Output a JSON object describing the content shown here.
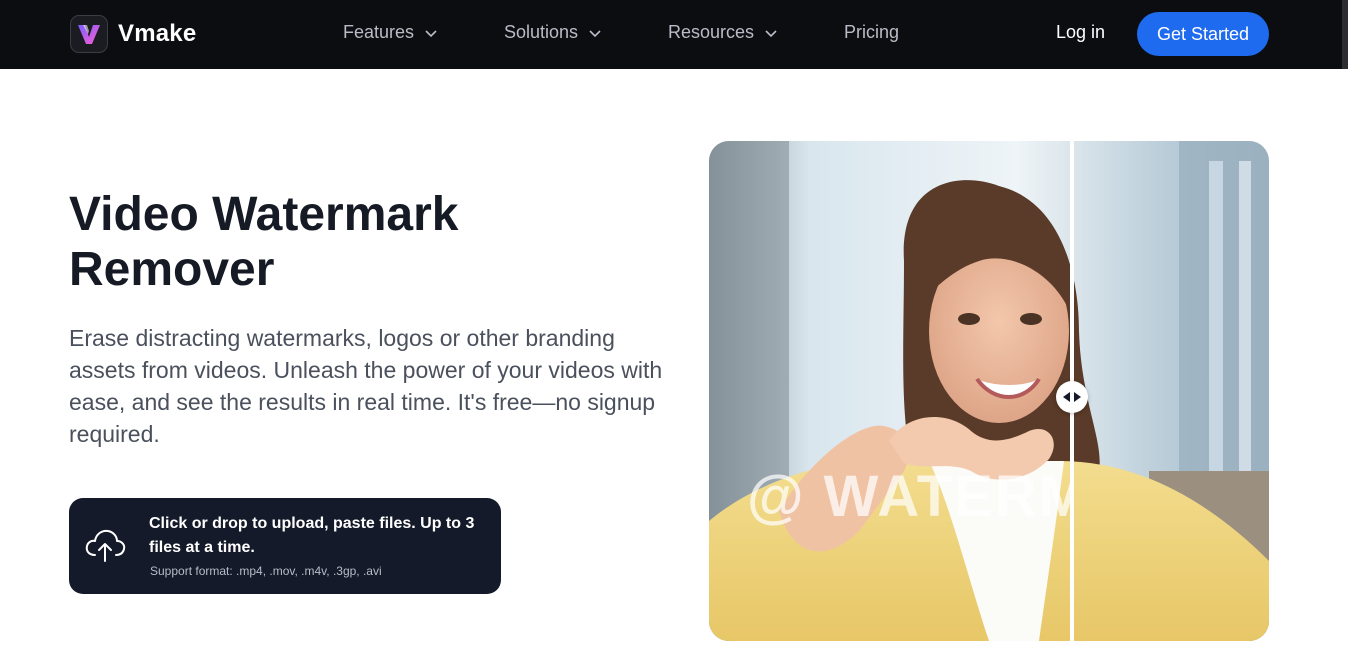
{
  "brand": {
    "name": "Vmake",
    "accent": "#1e6bef",
    "logo_gradient": [
      "#7b5cff",
      "#ff5fd0"
    ]
  },
  "nav": {
    "menu": [
      {
        "label": "Features",
        "has_dropdown": true
      },
      {
        "label": "Solutions",
        "has_dropdown": true
      },
      {
        "label": "Resources",
        "has_dropdown": true
      },
      {
        "label": "Pricing",
        "has_dropdown": false
      }
    ],
    "login_label": "Log in",
    "cta_label": "Get Started"
  },
  "hero": {
    "title_line1": "Video Watermark",
    "title_line2": "Remover",
    "description": "Erase distracting watermarks, logos or other branding assets from videos. Unleash the power of your videos with ease, and see the results in real time. It's free—no signup required."
  },
  "upload": {
    "icon": "cloud-upload-icon",
    "main_text": "Click or drop to upload, paste files. Up to 3 files at a time.",
    "support_text": "Support format: .mp4, .mov, .m4v, .3gp, .avi"
  },
  "preview": {
    "watermark_text": "@ WATERMARK",
    "handle_icon": "compare-arrows-icon"
  }
}
